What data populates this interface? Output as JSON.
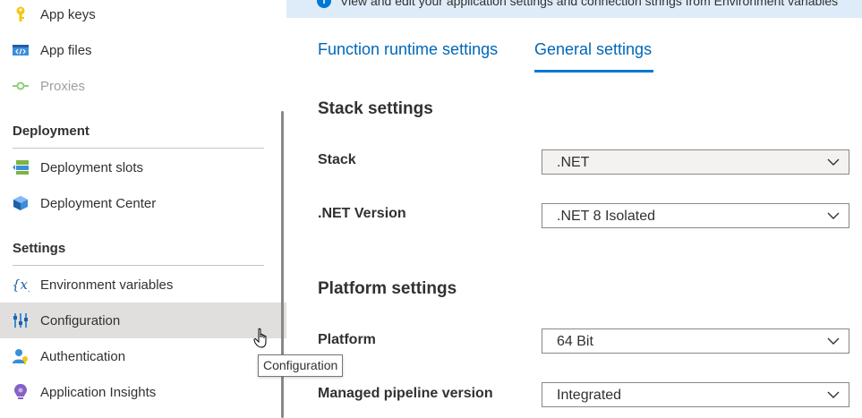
{
  "sidebar": {
    "items_top": [
      {
        "label": "App keys",
        "icon": "key-icon"
      },
      {
        "label": "App files",
        "icon": "code-file-icon"
      },
      {
        "label": "Proxies",
        "icon": "proxy-icon"
      }
    ],
    "deployment": {
      "title": "Deployment",
      "items": [
        {
          "label": "Deployment slots",
          "icon": "deployment-slots-icon"
        },
        {
          "label": "Deployment Center",
          "icon": "deployment-center-icon"
        }
      ]
    },
    "settings": {
      "title": "Settings",
      "items": [
        {
          "label": "Environment variables",
          "icon": "variable-icon"
        },
        {
          "label": "Configuration",
          "icon": "configuration-icon"
        },
        {
          "label": "Authentication",
          "icon": "authentication-icon"
        },
        {
          "label": "Application Insights",
          "icon": "application-insights-icon"
        }
      ]
    }
  },
  "banner": {
    "icon": "i",
    "text": "View and edit your application settings and connection strings from Environment variables"
  },
  "tabs": [
    {
      "label": "Function runtime settings"
    },
    {
      "label": "General settings"
    }
  ],
  "stack_settings": {
    "title": "Stack settings",
    "stack": {
      "label": "Stack",
      "value": ".NET"
    },
    "net_version": {
      "label": ".NET Version",
      "value": ".NET 8 Isolated"
    }
  },
  "platform_settings": {
    "title": "Platform settings",
    "platform": {
      "label": "Platform",
      "value": "64 Bit"
    },
    "pipeline": {
      "label": "Managed pipeline version",
      "value": "Integrated"
    }
  },
  "tooltip": {
    "text": "Configuration"
  },
  "colors": {
    "accent": "#0078d4",
    "link": "#0067b8",
    "banner": "#deecf9",
    "selected": "#e1dfdd"
  }
}
